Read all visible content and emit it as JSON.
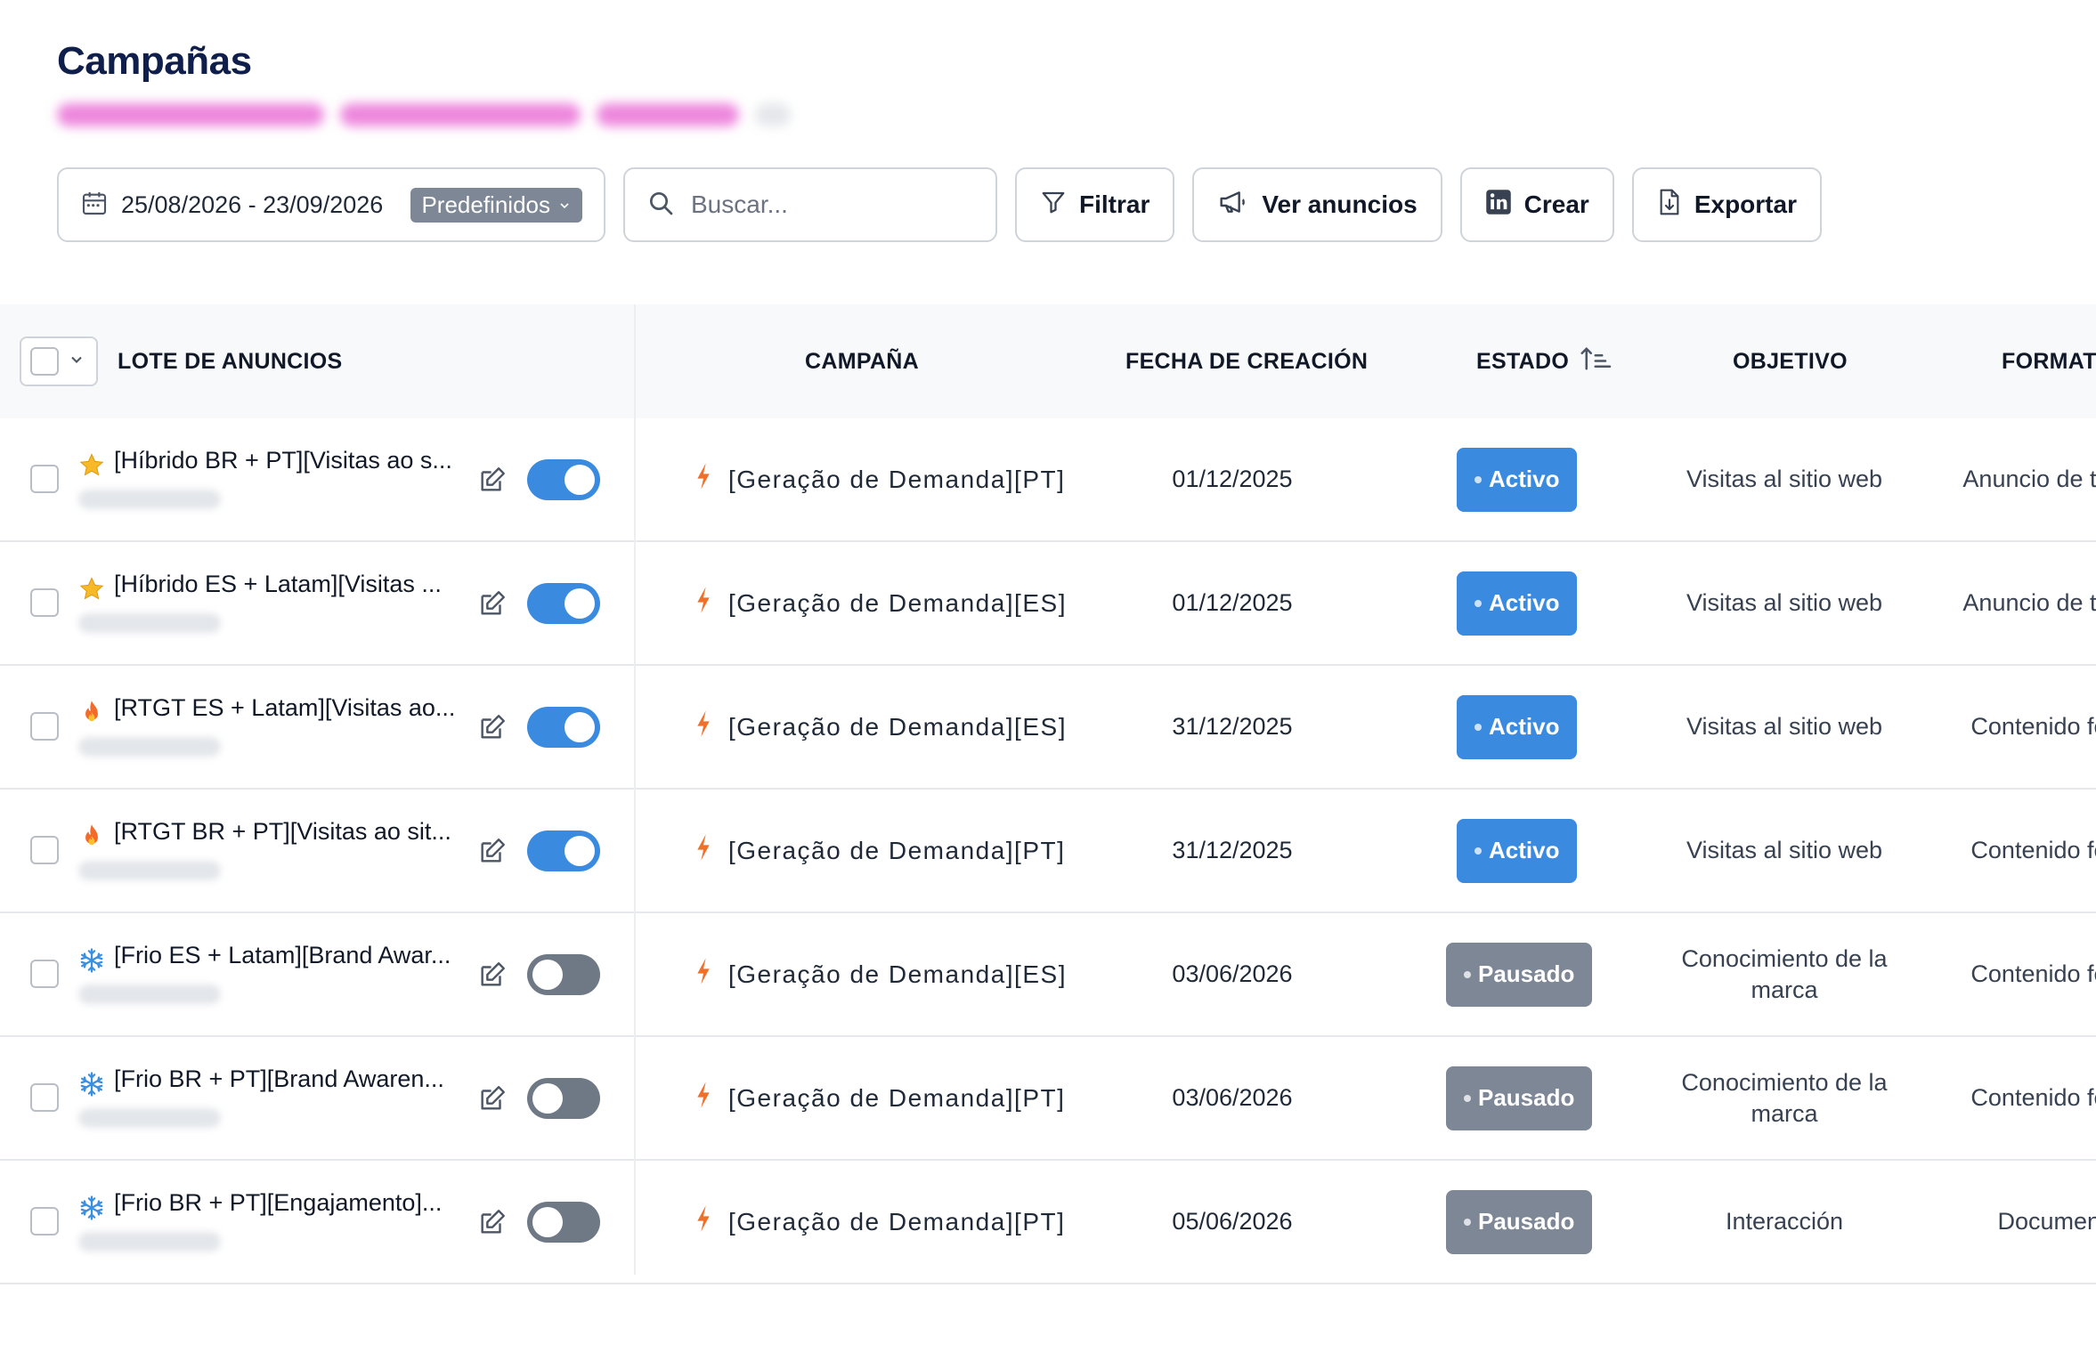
{
  "page": {
    "title": "Campañas"
  },
  "toolbar": {
    "date_range": "25/08/2026 - 23/09/2026",
    "preset_label": "Predefinidos",
    "search_placeholder": "Buscar...",
    "filter_label": "Filtrar",
    "view_ads_label": "Ver anuncios",
    "create_label": "Crear",
    "export_label": "Exportar"
  },
  "table": {
    "headers": {
      "lote": "LOTE DE ANUNCIOS",
      "campana": "CAMPAÑA",
      "fecha": "FECHA DE CREACIÓN",
      "estado": "ESTADO",
      "objetivo": "OBJETIVO",
      "formato": "FORMATO"
    },
    "rows": [
      {
        "icon": "star-icon",
        "name": "[Híbrido BR + PT][Visitas ao s...",
        "enabled": true,
        "campaign": "[Geração de Demanda][PT]",
        "date": "01/12/2025",
        "status": "Activo",
        "objective": "Visitas al sitio web",
        "format": "Anuncio de texto"
      },
      {
        "icon": "star-icon",
        "name": "[Híbrido ES + Latam][Visitas ...",
        "enabled": true,
        "campaign": "[Geração de Demanda][ES]",
        "date": "01/12/2025",
        "status": "Activo",
        "objective": "Visitas al sitio web",
        "format": "Anuncio de texto"
      },
      {
        "icon": "fire-icon",
        "name": "[RTGT ES + Latam][Visitas ao...",
        "enabled": true,
        "campaign": "[Geração de Demanda][ES]",
        "date": "31/12/2025",
        "status": "Activo",
        "objective": "Visitas al sitio web",
        "format": "Contenido feed"
      },
      {
        "icon": "fire-icon",
        "name": "[RTGT BR + PT][Visitas ao sit...",
        "enabled": true,
        "campaign": "[Geração de Demanda][PT]",
        "date": "31/12/2025",
        "status": "Activo",
        "objective": "Visitas al sitio web",
        "format": "Contenido feed"
      },
      {
        "icon": "snowflake-icon",
        "name": "[Frio ES + Latam][Brand Awar...",
        "enabled": false,
        "campaign": "[Geração de Demanda][ES]",
        "date": "03/06/2026",
        "status": "Pausado",
        "objective": "Conocimiento de la marca",
        "format": "Contenido feed"
      },
      {
        "icon": "snowflake-icon",
        "name": "[Frio BR + PT][Brand Awaren...",
        "enabled": false,
        "campaign": "[Geração de Demanda][PT]",
        "date": "03/06/2026",
        "status": "Pausado",
        "objective": "Conocimiento de la marca",
        "format": "Contenido feed"
      },
      {
        "icon": "snowflake-icon",
        "name": "[Frio BR + PT][Engajamento]...",
        "enabled": false,
        "campaign": "[Geração de Demanda][PT]",
        "date": "05/06/2026",
        "status": "Pausado",
        "objective": "Interacción",
        "format": "Document"
      }
    ]
  },
  "colors": {
    "title": "#0f1e4a",
    "active": "#3a8be0",
    "paused": "#7d8796",
    "accent_bolt": "#f0702a"
  }
}
